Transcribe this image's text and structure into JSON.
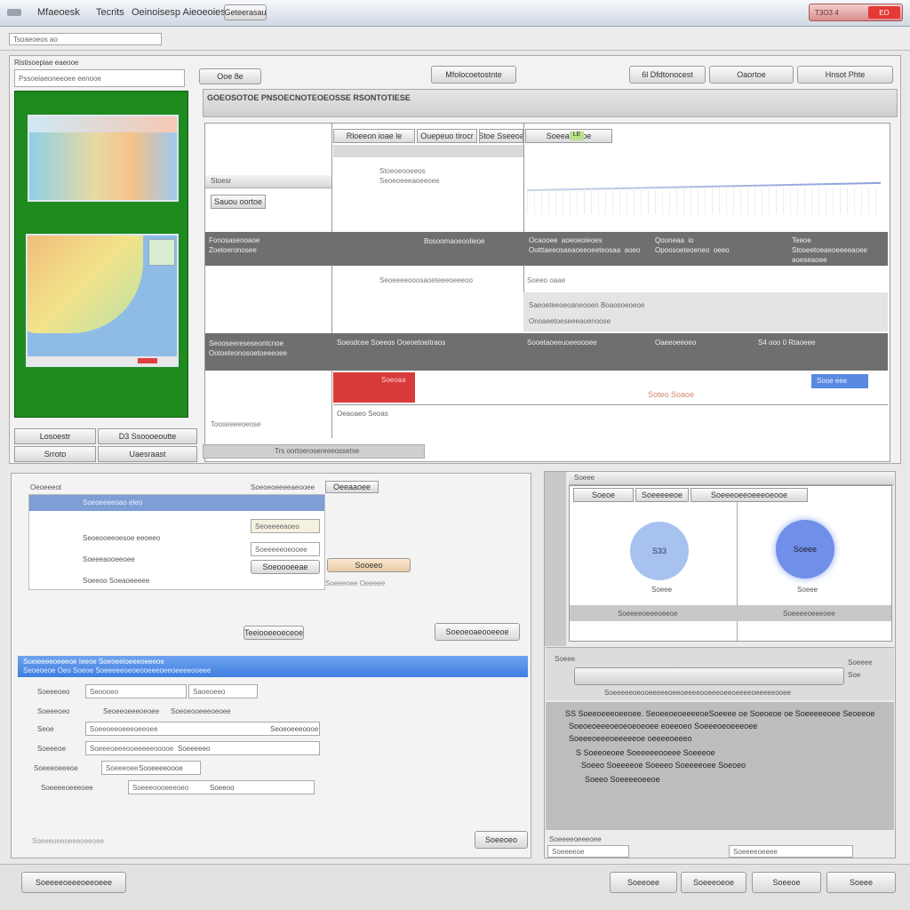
{
  "window": {
    "title_a": "Mfaeoesk",
    "title_b": "Tecrits",
    "title_c": "Oeinoisesp Aieoeoiesou",
    "title_d": "Geteerasau",
    "controls_text": "T3O3 4",
    "close_label": "EO",
    "accent_close": "#e53935"
  },
  "toolbar": {
    "address_text": "Tsoaeoeos ao"
  },
  "top_panel": {
    "section_label": "Ristisoepiae eaeooe",
    "side_field": "Pssoeiaeoneeoee eenooe",
    "nav_field": "Ooe 8e",
    "center_button": "Mfolocoetostnte",
    "right_button_1": "6l Dfdtonocest",
    "right_button_2": "Oaortoe",
    "right_button_3": "Hnsot Phte",
    "header_strip": "GOEOSOTOE PNSOECNOTEOEOSSE  RSONTOTIESE",
    "green_panel_color": "#1f8a1f",
    "left_tabs": [
      "Losoestr",
      "D3 Ssoooeoutte",
      "Srroto",
      "Uaesraast"
    ],
    "status_footer": "Trs oortoerosereeeossetse"
  },
  "grid_area": {
    "left_header": "Stoesr",
    "left_button": "Sauou oortoe",
    "tab_1": "Rloeeon  ioae le",
    "tab_2": "Ouepeuo  tirocr",
    "tab_3": "Stoe  Sseeoa",
    "tab_4": "Soeeaoe  ioe",
    "tab_4_badge": "LE",
    "row_a_left": "Fonosasenoaoe\nZoetoeronosee",
    "row_a_mid": "Bosoomaoeoolieoe",
    "row_a_right1": "Ocaooee  aoeoeoieoes\nOotttaeeosaeaoeeoeeteosaa  aoeo",
    "row_a_right2": "Qooneaa  io\nOpoosoeteoeneo  oeeo",
    "row_a_right3": "Teeoe\nStoseetoeaeoeeeeaoee\naoeseaoee",
    "row_b_left": "Seooseereseseontcnoe\nOotoeteonosoetoeeeoee",
    "row_b_mid": "Soeodcee  Soeeos  Ooeoetoeitraos",
    "row_b_right1": "Sooetaoeeuoeeoooee",
    "row_b_right2": "Oaeeoeeoeo",
    "row_b_right3": "S4  ooo  0  Rtaoeee",
    "mid_text_1": "Stoeoeooeeos\nSeoeoeeeaoeeoee",
    "mid_text_2": "Seoeeeeooosaoeteeeoeeeoo",
    "mid_text_3": "Soeeo oaae",
    "mid_text_4": "Saeoeteeoeoaneooen Boaosoeoeoe",
    "mid_text_5": "Onoaeetoeseeeaoenoose",
    "row_c_left": "Tooseeeeoeose",
    "row_c_red_text": "Soeoaa",
    "row_c_blue": "Sooe  eee",
    "row_c_orange": "Soteo  Soaoe",
    "row_c_label": "Oeaoaeo  Seoas",
    "red_cell_color": "#d83a3a",
    "blue_cell_color": "#5a8ae0"
  },
  "form_panel": {
    "top_left": "Oeoeeeot",
    "top_right": "Soeoeoeeeeaeooee",
    "top_button": "Oeeaaoee",
    "blue_header": "Soeoeeeeoao  eleo",
    "row_1": "Seoeooeeoesoe eeoeeo",
    "row_2": "Soeeeaooeeoee",
    "row_3": "Soeeoo  Soeaoeeeee",
    "row_4": "Soeeeoee  Oeeeee",
    "side_field_1": "Seoeeeeaoeo",
    "side_field_2": "Soeeeeeoeooee",
    "side_field_3": "Sooeeo",
    "side_button": "Soeoooeeae",
    "mid_button": "Teeiooeeoeceoe",
    "right_button": "Soeoeoaeooeeoe",
    "info_title": "Soeieeeeoeeeoe  Ieeoe  Soeoeeioeeeoeeeoe",
    "info_subtitle": "Seoeoeoe  Oeo  Soeoe  Soeeeeeoeoeooeeeoeeoeeeeooeee",
    "form_rows": [
      [
        "Soeeeoeo",
        "Seoooeo",
        "Saoeoeeo"
      ],
      [
        "Soeeeoeo",
        "Seoeeoeeeoeoee",
        "Soeoeooeeeoeoee"
      ],
      [
        "Seoe",
        "Soeeoeeoeeeoeeoee",
        "Seoeoeeeoooe"
      ],
      [
        "Soeeeoe",
        "Soeeeoeeeooeeeeeooooe",
        "Soeeeeeo"
      ],
      [
        "Soeeeoeeeoe",
        "Soeeeoee",
        "Sooeeeeoooe"
      ],
      [
        "Soeeeeoeeeoee",
        "Soeeeoooeeeoeo",
        "Soeeoo"
      ]
    ],
    "footer_left": "Soeeeoeeoeeeoeeoee",
    "footer_button": "Soeeoeo"
  },
  "right_panel": {
    "header": "Soeee",
    "tab_1": "Soeoe",
    "tab_2": "Soeeeeeoe",
    "tab_3": "Soeeeoeeoeeeoeooe",
    "circle_1_text": "S33",
    "circle_1_label": "Soeee",
    "circle_2_text": "Soeee",
    "circle_2_label": "Soeee",
    "footer_1": "Soeeeeoeeeoeeoe",
    "footer_2": "Soeeeeoeeeoee",
    "circle_1_color": "#a8c2f0",
    "circle_2_color": "#6f8fe8",
    "progress_label": "Soeee",
    "progress_side": "Soeeee\nSoe",
    "progress_caption": "Soeeeeeoeooeeeeeoeeoeeeeooeeeoeeoeeeeoeeeeeooee",
    "bullets": [
      "SS Soeeoeeeoeeoee. SeoeeoeoeeeeoeSoeeee oe Soeoeoe oe Soeeeeeoee Seoeeoe",
      "Soeoeoeeeoeoeoeoeoee eoeeoeo Soeeeoeoeeeoee",
      "Soeeeoeeeoeeeeeoe oeeeeoeeeo",
      "S  Soeeoeoee Soeeeeeooeee  Soeeeoe",
      "Soeeo Soeeeeoe  Soeeeo Soeeeeoee  Soeoeo",
      "Soeeo  Soeeeeoeeoe"
    ],
    "footer_label": "Soeeeeoeeeoee",
    "footer_field_1": "Soeeeeoe",
    "footer_field_2": "Soeeeeoeeee"
  },
  "bottom_bar": {
    "left_button": "Soeeeeoeeeoeeoeee",
    "button_1": "Soeeoee",
    "button_2": "Soeeeoeoe",
    "button_3": "Soeeoe",
    "button_4": "Soeee"
  }
}
